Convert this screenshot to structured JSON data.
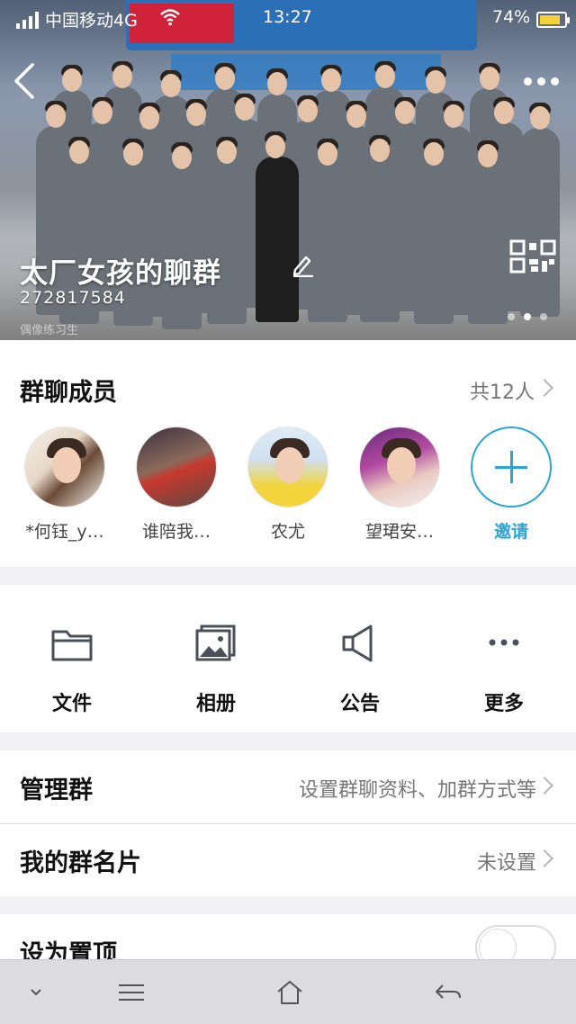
{
  "status_bar": {
    "carrier": "中国移动4G",
    "time": "13:27",
    "battery": "74%"
  },
  "header": {
    "group_name": "太厂女孩的聊群",
    "group_id": "272817584",
    "watermark": "偶像练习生",
    "carousel_pages": 3,
    "carousel_active": 2
  },
  "members": {
    "title": "群聊成员",
    "count": "共12人",
    "list": [
      {
        "name": "*何钰_y…"
      },
      {
        "name": "谁陪我…"
      },
      {
        "name": "农尤"
      },
      {
        "name": "望珺安…"
      }
    ],
    "invite_label": "邀请"
  },
  "actions": [
    {
      "label": "文件",
      "icon": "folder-icon"
    },
    {
      "label": "相册",
      "icon": "album-icon"
    },
    {
      "label": "公告",
      "icon": "announcement-icon"
    },
    {
      "label": "更多",
      "icon": "more-dots-icon"
    }
  ],
  "settings": {
    "manage": {
      "title": "管理群",
      "value": "设置群聊资料、加群方式等"
    },
    "card": {
      "title": "我的群名片",
      "value": "未设置"
    },
    "pin": {
      "title": "设为置顶",
      "enabled": false
    }
  },
  "colors": {
    "accent": "#2ba5d8",
    "secondary_text": "#777777"
  }
}
